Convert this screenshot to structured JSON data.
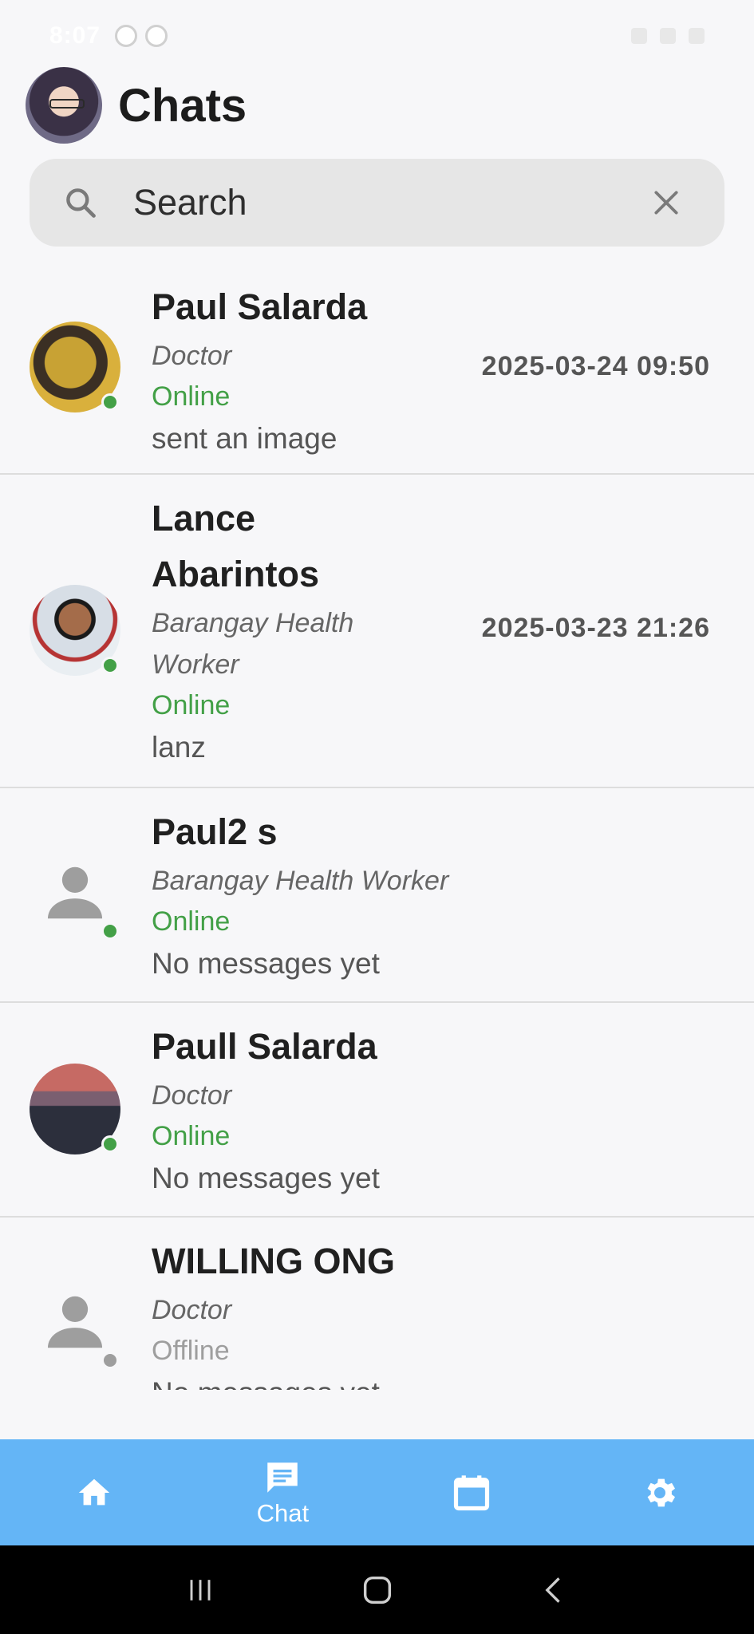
{
  "status_bar": {
    "time": "8:07"
  },
  "header": {
    "title": "Chats"
  },
  "search": {
    "placeholder": "Search"
  },
  "chats": [
    {
      "name": "Paul Salarda",
      "role": "Doctor",
      "presence": "Online",
      "last_message": "sent an image",
      "timestamp": "2025-03-24 09:50"
    },
    {
      "name": "Lance Abarintos",
      "role": "Barangay Health Worker",
      "presence": "Online",
      "last_message": "lanz",
      "timestamp": "2025-03-23 21:26"
    },
    {
      "name": "Paul2 s",
      "role": "Barangay Health Worker",
      "presence": "Online",
      "last_message": "No messages yet",
      "timestamp": ""
    },
    {
      "name": "Paull Salarda",
      "role": "Doctor",
      "presence": "Online",
      "last_message": "No messages yet",
      "timestamp": ""
    },
    {
      "name": "WILLING ONG",
      "role": "Doctor",
      "presence": "Offline",
      "last_message": "No messages yet",
      "timestamp": ""
    }
  ],
  "bottom_nav": {
    "items": [
      {
        "icon": "home-icon",
        "label": ""
      },
      {
        "icon": "chat-icon",
        "label": "Chat"
      },
      {
        "icon": "calendar-icon",
        "label": ""
      },
      {
        "icon": "gear-icon",
        "label": ""
      }
    ],
    "active": "Chat"
  },
  "colors": {
    "accent": "#64b5f6",
    "online": "#43a047",
    "offline": "#9e9e9e"
  }
}
